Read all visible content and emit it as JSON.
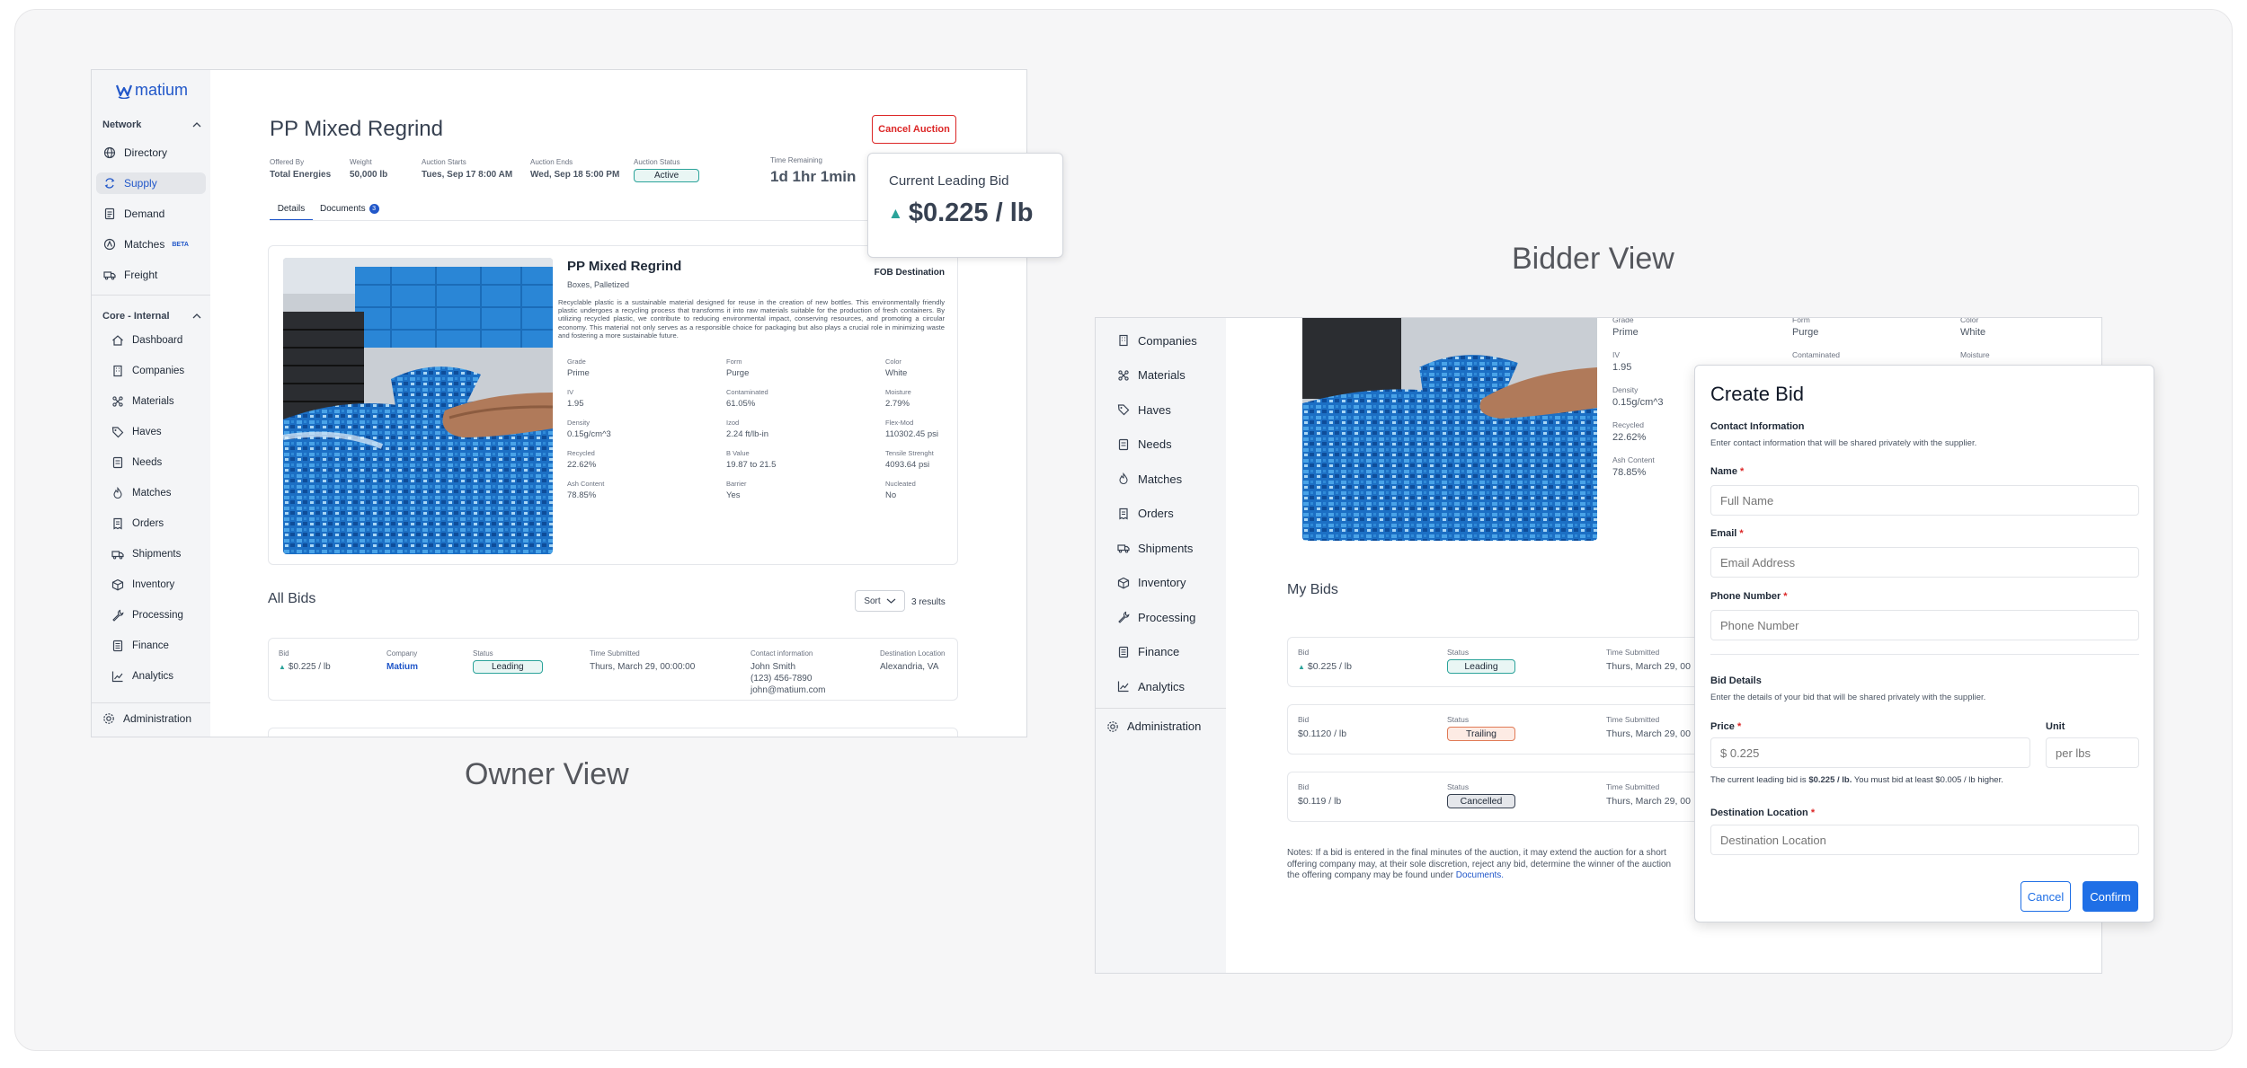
{
  "owner_view": {
    "caption": "Owner View",
    "brand": "matium",
    "sidebar": {
      "network_label": "Network",
      "network_items": [
        "Directory",
        "Supply",
        "Demand",
        "Matches",
        "Freight"
      ],
      "beta_label": "BETA",
      "core_label": "Core - Internal",
      "core_items": [
        "Dashboard",
        "Companies",
        "Materials",
        "Haves",
        "Needs",
        "Matches",
        "Orders",
        "Shipments",
        "Inventory",
        "Processing",
        "Finance",
        "Analytics"
      ],
      "admin_label": "Administration"
    },
    "header": {
      "title": "PP Mixed Regrind",
      "cancel_label": "Cancel Auction",
      "meta": [
        {
          "label": "Offered By",
          "value": "Total Energies"
        },
        {
          "label": "Weight",
          "value": "50,000 lb"
        },
        {
          "label": "Auction Starts",
          "value": "Tues, Sep 17 8:00 AM"
        },
        {
          "label": "Auction Ends",
          "value": "Wed, Sep 18 5:00 PM"
        }
      ],
      "status_label": "Auction Status",
      "status_value": "Active",
      "time_label": "Time Remaining",
      "time_value": "1d 1hr 1min"
    },
    "tabs": {
      "details": "Details",
      "documents": "Documents",
      "documents_count": "3"
    },
    "leading_bid": {
      "label": "Current Leading Bid",
      "value": "$0.225 / lb"
    },
    "product": {
      "name": "PP Mixed Regrind",
      "packaging": "Boxes, Palletized",
      "terms": "FOB Destination",
      "description": "Recyclable plastic is a sustainable material designed for reuse in the creation of new bottles. This environmentally friendly plastic undergoes a recycling process that transforms it into raw materials suitable for the production of fresh containers. By utilizing recycled plastic, we contribute to reducing environmental impact, conserving resources, and promoting a circular economy. This material not only serves as a responsible choice for packaging but also plays a crucial role in minimizing waste and fostering a more sustainable future.",
      "specs": [
        {
          "label": "Grade",
          "value": "Prime"
        },
        {
          "label": "Form",
          "value": "Purge"
        },
        {
          "label": "Color",
          "value": "White"
        },
        {
          "label": "IV",
          "value": "1.95"
        },
        {
          "label": "Contaminated",
          "value": "61.05%"
        },
        {
          "label": "Moisture",
          "value": "2.79%"
        },
        {
          "label": "Density",
          "value": "0.15g/cm^3"
        },
        {
          "label": "Izod",
          "value": "2.24 ft/lb-in"
        },
        {
          "label": "Flex-Mod",
          "value": "110302.45 psi"
        },
        {
          "label": "Recycled",
          "value": "22.62%"
        },
        {
          "label": "B Value",
          "value": "19.87 to 21.5"
        },
        {
          "label": "Tensile Strenght",
          "value": "4093.64 psi"
        },
        {
          "label": "Ash Content",
          "value": "78.85%"
        },
        {
          "label": "Barrier",
          "value": "Yes"
        },
        {
          "label": "Nucleated",
          "value": "No"
        }
      ]
    },
    "all_bids": {
      "title": "All Bids",
      "sort_label": "Sort",
      "results": "3 results",
      "row": {
        "bid_label": "Bid",
        "bid_value": "$0.225 / lb",
        "company_label": "Company",
        "company_value": "Matium",
        "status_label": "Status",
        "status_value": "Leading",
        "time_label": "Time Submitted",
        "time_value": "Thurs, March 29, 00:00:00",
        "contact_label": "Contact information",
        "contact_name": "John Smith",
        "contact_phone": "(123) 456-7890",
        "contact_email": "john@matium.com",
        "dest_label": "Destination Location",
        "dest_value": "Alexandria, VA"
      }
    }
  },
  "bidder_view": {
    "caption": "Bidder View",
    "sidebar": {
      "items": [
        "Companies",
        "Materials",
        "Haves",
        "Needs",
        "Matches",
        "Orders",
        "Shipments",
        "Inventory",
        "Processing",
        "Finance",
        "Analytics"
      ],
      "admin_label": "Administration"
    },
    "specs": [
      {
        "label": "Grade",
        "value": "Prime"
      },
      {
        "label": "Form",
        "value": "Purge"
      },
      {
        "label": "Color",
        "value": "White"
      },
      {
        "label": "IV",
        "value": "1.95"
      },
      {
        "label": "Contaminated",
        "value": ""
      },
      {
        "label": "Moisture",
        "value": ""
      },
      {
        "label": "Density",
        "value": "0.15g/cm^3"
      },
      {
        "label": "Recycled",
        "value": "22.62%"
      },
      {
        "label": "Ash Content",
        "value": "78.85%"
      }
    ],
    "my_bids": {
      "title": "My Bids",
      "rows": [
        {
          "bid_label": "Bid",
          "bid_value": "$0.225 / lb",
          "status_label": "Status",
          "status_value": "Leading",
          "time_label": "Time Submitted",
          "time_value": "Thurs, March 29, 00"
        },
        {
          "bid_label": "Bid",
          "bid_value": "$0.1120 / lb",
          "status_label": "Status",
          "status_value": "Trailing",
          "time_label": "Time Submitted",
          "time_value": "Thurs, March 29, 00"
        },
        {
          "bid_label": "Bid",
          "bid_value": "$0.119 / lb",
          "status_label": "Status",
          "status_value": "Cancelled",
          "time_label": "Time Submitted",
          "time_value": "Thurs, March 29, 00"
        }
      ],
      "notes_line1": "Notes: If a bid is entered in the final minutes of the auction, it may extend the auction for a short",
      "notes_line2": "offering company may, at their sole discretion, reject any bid, determine the winner of the auction",
      "notes_line3": "the offering company may be found under",
      "notes_link": "Documents."
    },
    "create_bid": {
      "title": "Create Bid",
      "contact_heading": "Contact Information",
      "contact_sub": "Enter contact information that will be shared privately with the supplier.",
      "name_label": "Name",
      "name_placeholder": "Full Name",
      "email_label": "Email",
      "email_placeholder": "Email Address",
      "phone_label": "Phone Number",
      "phone_placeholder": "Phone Number",
      "bid_heading": "Bid Details",
      "bid_sub": "Enter the details of your bid that will be shared privately with the supplier.",
      "price_label": "Price",
      "price_placeholder": "$ 0.225",
      "unit_label": "Unit",
      "unit_placeholder": "per lbs",
      "leading_note_pre": "The current leading bid is",
      "leading_note_value": "$0.225 / lb.",
      "leading_note_post": "You must bid at least $0.005 / lb higher.",
      "dest_label": "Destination Location",
      "dest_placeholder": "Destination Location",
      "cancel_label": "Cancel",
      "confirm_label": "Confirm",
      "required_mark": "*"
    }
  },
  "colors": {
    "brand": "#2157c9",
    "danger": "#dc2626",
    "leading": "#2ba39a",
    "confirm": "#1f6fe6"
  }
}
